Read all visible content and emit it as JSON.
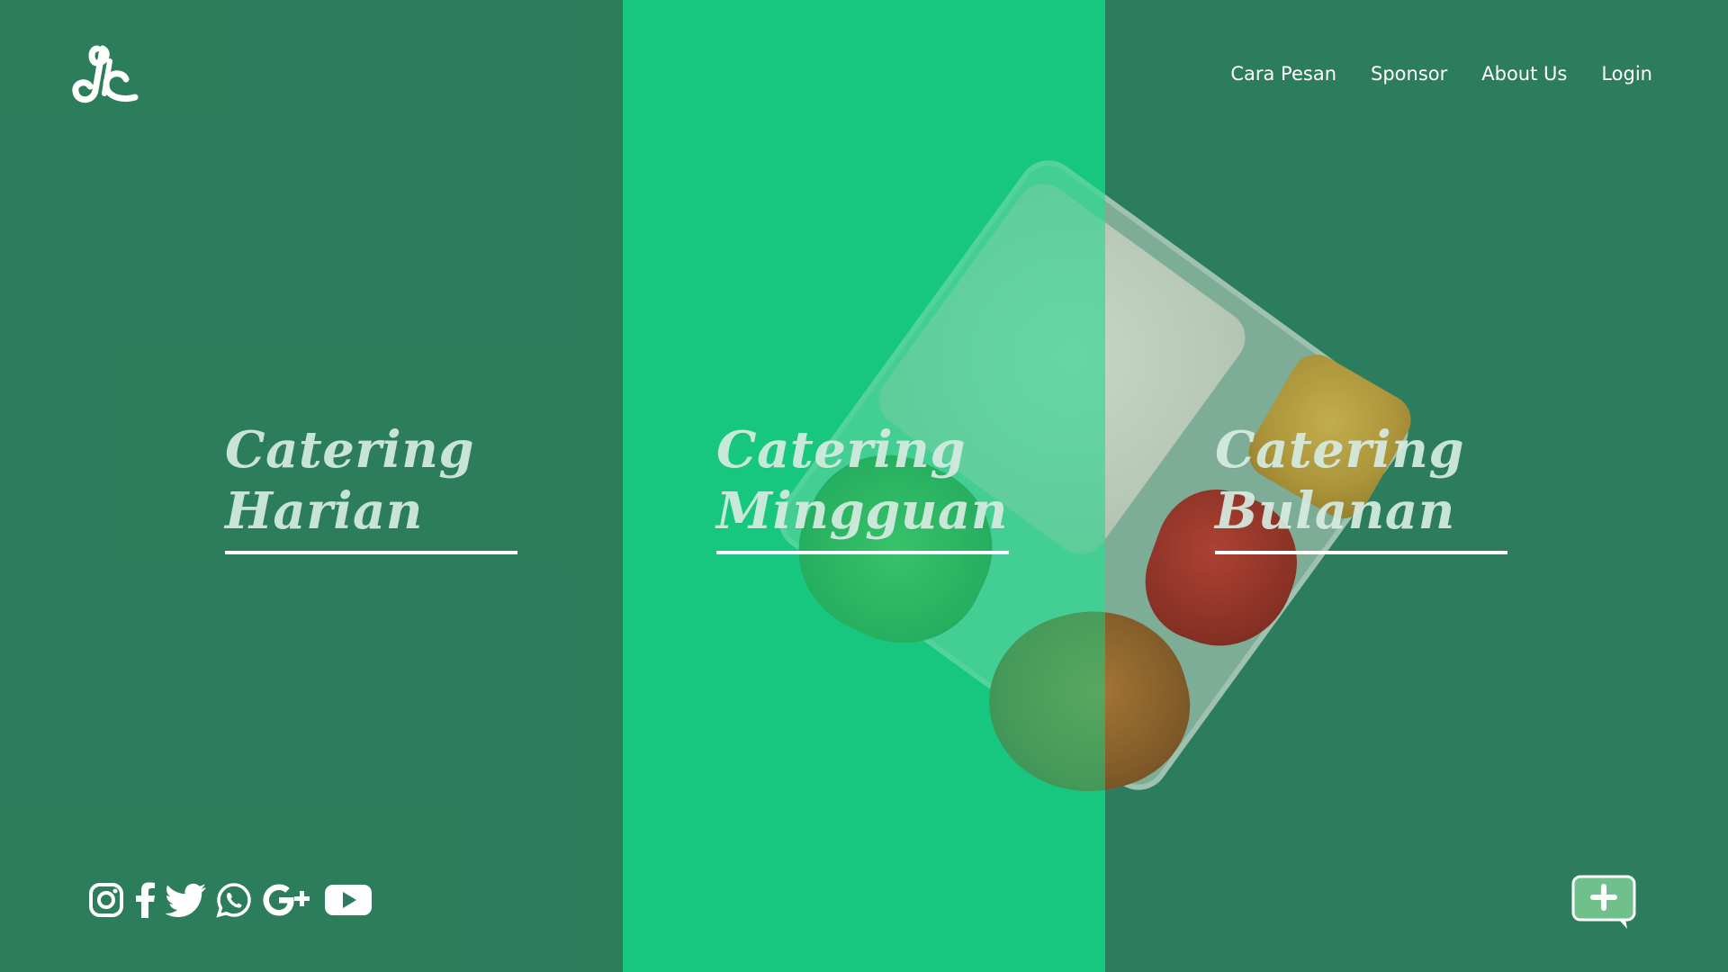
{
  "brand": {
    "logo_icon": "jc-script-logo-icon"
  },
  "nav": {
    "items": [
      {
        "label": "Cara Pesan"
      },
      {
        "label": "Sponsor"
      },
      {
        "label": "About Us"
      },
      {
        "label": "Login"
      }
    ]
  },
  "catering": [
    {
      "line1": "Catering",
      "line2": "Harian"
    },
    {
      "line1": "Catering",
      "line2": "Mingguan"
    },
    {
      "line1": "Catering",
      "line2": "Bulanan"
    }
  ],
  "social": {
    "icons": [
      "instagram-icon",
      "facebook-icon",
      "twitter-icon",
      "whatsapp-icon",
      "google-plus-icon",
      "youtube-icon"
    ]
  },
  "chat": {
    "icon": "chat-plus-icon"
  },
  "colors": {
    "dark_green": "#2c7d5d",
    "bright_green": "#18c77f",
    "text": "#ffffff",
    "chat_button": "#6fc08b"
  }
}
